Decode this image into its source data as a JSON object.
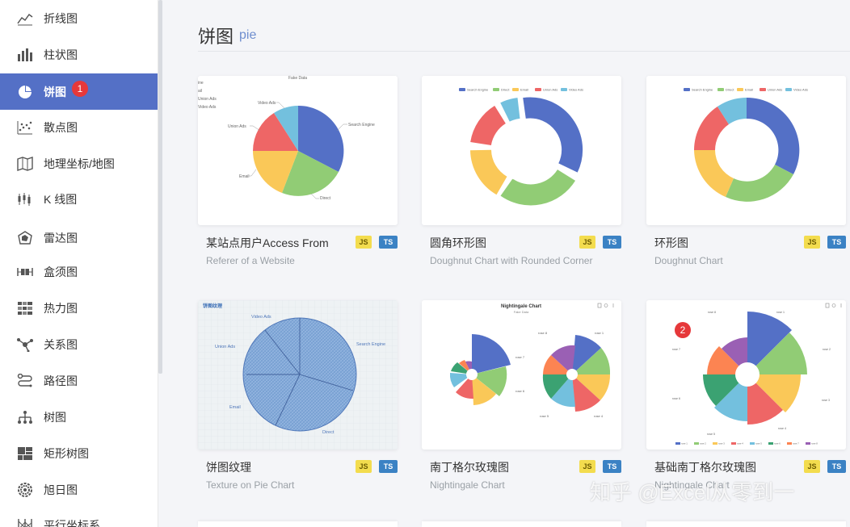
{
  "sidebar": {
    "items": [
      {
        "label": "折线图",
        "icon": "line-chart-icon"
      },
      {
        "label": "柱状图",
        "icon": "bar-chart-icon"
      },
      {
        "label": "饼图",
        "icon": "pie-chart-icon",
        "active": true,
        "badge": "1"
      },
      {
        "label": "散点图",
        "icon": "scatter-chart-icon"
      },
      {
        "label": "地理坐标/地图",
        "icon": "map-icon"
      },
      {
        "label": "K 线图",
        "icon": "candlestick-icon"
      },
      {
        "label": "雷达图",
        "icon": "radar-icon"
      },
      {
        "label": "盒须图",
        "icon": "boxplot-icon"
      },
      {
        "label": "热力图",
        "icon": "heatmap-icon"
      },
      {
        "label": "关系图",
        "icon": "graph-icon"
      },
      {
        "label": "路径图",
        "icon": "lines-icon"
      },
      {
        "label": "树图",
        "icon": "tree-icon"
      },
      {
        "label": "矩形树图",
        "icon": "treemap-icon"
      },
      {
        "label": "旭日图",
        "icon": "sunburst-icon"
      },
      {
        "label": "平行坐标系",
        "icon": "parallel-icon"
      }
    ]
  },
  "header": {
    "title": "饼图",
    "subtitle": "pie"
  },
  "tags": {
    "js": "JS",
    "ts": "TS"
  },
  "cards": [
    {
      "title": "某站点用户Access From",
      "subtitle": "Referer of a Website"
    },
    {
      "title": "圆角环形图",
      "subtitle": "Doughnut Chart with Rounded Corner"
    },
    {
      "title": "环形图",
      "subtitle": "Doughnut Chart"
    },
    {
      "title": "饼图纹理",
      "subtitle": "Texture on Pie Chart"
    },
    {
      "title": "南丁格尔玫瑰图",
      "subtitle": "Nightingale Chart"
    },
    {
      "title": "基础南丁格尔玫瑰图",
      "subtitle": "Nightingale Chart"
    }
  ],
  "annotation_badge": "2",
  "thumbs": {
    "pie1": {
      "title": "Fake Data",
      "labels": [
        "Search Engine",
        "Direct",
        "Email",
        "Union Ads",
        "Video Ads"
      ],
      "legend": [
        "ine",
        "ail",
        "Union Ads",
        "Video Ads"
      ]
    },
    "legend5": [
      "Search Engine",
      "Direct",
      "Email",
      "Union Ads",
      "Video Ads"
    ],
    "texture": {
      "title": "饼图纹理",
      "labels": [
        "Video Ads",
        "Union Ads",
        "Search Engine",
        "Email",
        "Direct"
      ]
    },
    "nightingale": {
      "title": "Nightingale Chart",
      "subtitle": "Fake Data",
      "labels": [
        "rose 1",
        "rose 4",
        "rose 5",
        "rose 6",
        "rose 7",
        "rose 8"
      ]
    },
    "basic_rose": {
      "labels": [
        "rose 1",
        "rose 2",
        "rose 3",
        "rose 4",
        "rose 5",
        "rose 6",
        "rose 7",
        "rose 8"
      ]
    }
  },
  "watermark": "知乎 @Excel从零到一",
  "colors": {
    "accent": "#5470c6",
    "badge": "#e6383a",
    "palette": [
      "#5470c6",
      "#91cc75",
      "#fac858",
      "#ee6666",
      "#73c0de",
      "#3ba272",
      "#fc8452",
      "#9a60b4"
    ]
  }
}
